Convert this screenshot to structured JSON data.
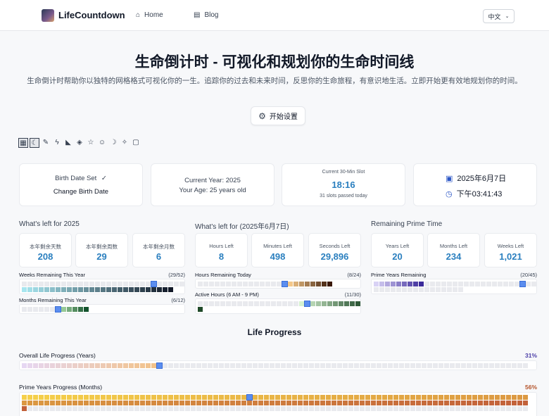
{
  "nav": {
    "brand": "LifeCountdown",
    "home": "Home",
    "blog": "Blog",
    "language": "中文"
  },
  "hero": {
    "title": "生命倒计时 - 可视化和规划你的生命时间线",
    "subtitle": "生命倒计时帮助你以独特的网格格式可视化你的一生。追踪你的过去和未来时间，反思你的生命旅程，有意识地生活。立即开始更有效地规划你的时间。",
    "start_button": "开始设置"
  },
  "toolbar": {
    "icons": [
      "grid-icon",
      "moon-icon",
      "brush-icon",
      "lightning-icon",
      "leaf-icon",
      "candy-icon",
      "star-icon",
      "smile-icon",
      "crescent-icon",
      "sparkle-icon",
      "square-icon"
    ],
    "glyphs": [
      "▦",
      "☾",
      "✎",
      "ϟ",
      "◣",
      "◈",
      "☆",
      "☺",
      "☽",
      "✧",
      "▢"
    ]
  },
  "info": {
    "birth_set": "Birth Date Set",
    "birth_check": "✓",
    "change_birth": "Change Birth Date",
    "current_year": "Current Year: 2025",
    "your_age": "Your Age: 25 years old",
    "slot_label": "Current 30-Min Slot",
    "slot_time": "18:16",
    "slots_passed": "31 slots passed today",
    "date": "2025年6月7日",
    "time": "下午03:41:43"
  },
  "year_section": {
    "title": "What's left for 2025",
    "stats": [
      {
        "label": "本年剩余天数",
        "value": "208"
      },
      {
        "label": "本年剩余周数",
        "value": "29"
      },
      {
        "label": "本年剩余月数",
        "value": "6"
      }
    ],
    "weeks_label": "Weeks Remaining This Year",
    "weeks_count": "(29/52)",
    "months_label": "Months Remaining This Year",
    "months_count": "(6/12)"
  },
  "day_section": {
    "title": "What's left for (2025年6月7日)",
    "stats": [
      {
        "label": "Hours Left",
        "value": "8"
      },
      {
        "label": "Minutes Left",
        "value": "498"
      },
      {
        "label": "Seconds Left",
        "value": "29,896"
      }
    ],
    "hours_label": "Hours Remaining Today",
    "hours_count": "(8/24)",
    "active_label": "Active Hours (6 AM - 9 PM)",
    "active_count": "(11/30)"
  },
  "prime_section": {
    "title": "Remaining Prime Time",
    "stats": [
      {
        "label": "Years Left",
        "value": "20"
      },
      {
        "label": "Months Left",
        "value": "234"
      },
      {
        "label": "Weeks Left",
        "value": "1,021"
      }
    ],
    "prime_label": "Prime Years Remaining",
    "prime_count": "(20/45)"
  },
  "life": {
    "title": "Life Progress",
    "overall_label": "Overall Life Progress (Years)",
    "overall_pct": "31%",
    "prime_label": "Prime Years Progress (Months)",
    "prime_pct": "56%"
  },
  "colors": {
    "accent_blue": "#2a7fbf",
    "marker": "#5b8def",
    "empty_cell": "#e9eaee",
    "overall_pct_color": "#4c3fa8",
    "prime_pct_color": "#b4532a"
  }
}
